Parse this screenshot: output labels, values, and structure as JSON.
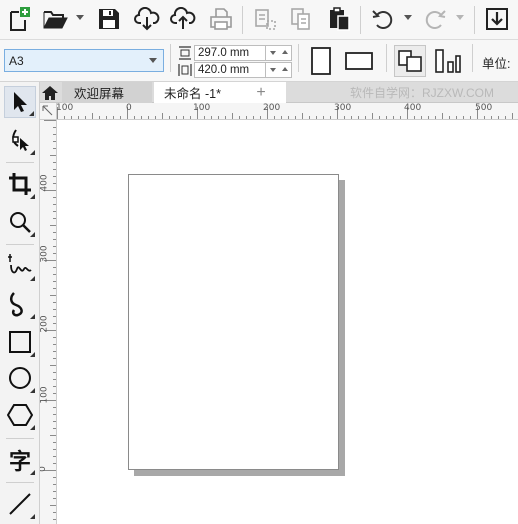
{
  "toolbar": {
    "buttons": [
      {
        "name": "new-document",
        "icon": "new-document-icon"
      },
      {
        "name": "open",
        "icon": "folder-open-icon"
      },
      {
        "name": "save",
        "icon": "floppy-disk-icon"
      },
      {
        "name": "download",
        "icon": "cloud-download-icon"
      },
      {
        "name": "upload",
        "icon": "cloud-upload-icon"
      },
      {
        "name": "print",
        "icon": "printer-icon"
      },
      {
        "name": "cut",
        "icon": "cut-icon"
      },
      {
        "name": "copy",
        "icon": "copy-icon"
      },
      {
        "name": "paste",
        "icon": "clipboard-paste-icon"
      },
      {
        "name": "undo",
        "icon": "undo-icon"
      },
      {
        "name": "redo",
        "icon": "redo-icon"
      },
      {
        "name": "import",
        "icon": "import-arrow-icon"
      }
    ]
  },
  "property_bar": {
    "page_size": "A3",
    "width_value": "297.0 mm",
    "height_value": "420.0 mm",
    "units_label": "单位:"
  },
  "tabs": {
    "welcome": "欢迎屏幕",
    "document": "未命名 -1*"
  },
  "watermark": "软件自学网：RJZXW.COM",
  "ruler": {
    "horizontal": [
      "100",
      "0",
      "100",
      "200",
      "300",
      "400",
      "500"
    ],
    "vertical": [
      "400",
      "300",
      "200",
      "100",
      "0"
    ]
  },
  "toolbox": [
    {
      "name": "pick-tool",
      "icon": "arrow-pointer-icon"
    },
    {
      "name": "shape-tool",
      "icon": "shape-edit-icon"
    },
    {
      "name": "crop-tool",
      "icon": "crop-icon"
    },
    {
      "name": "zoom-tool",
      "icon": "magnifier-icon"
    },
    {
      "name": "freehand-tool",
      "icon": "freehand-icon"
    },
    {
      "name": "artistic-media-tool",
      "icon": "curve-icon"
    },
    {
      "name": "rectangle-tool",
      "icon": "rectangle-icon"
    },
    {
      "name": "ellipse-tool",
      "icon": "ellipse-icon"
    },
    {
      "name": "polygon-tool",
      "icon": "hexagon-icon"
    },
    {
      "name": "text-tool",
      "icon": "text-icon",
      "label": "字"
    },
    {
      "name": "line-tool",
      "icon": "diagonal-line-icon"
    }
  ],
  "colors": {
    "accent": "#7aaee0",
    "select_bg": "#e3f0fb",
    "new_doc_plus": "#2e9e3e"
  }
}
